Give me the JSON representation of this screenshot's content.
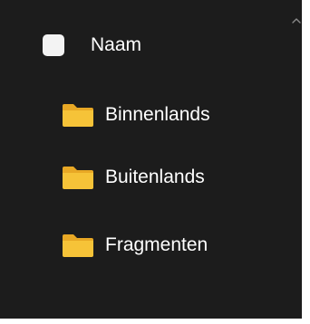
{
  "header": {
    "name_column_label": "Naam"
  },
  "folders": [
    {
      "label": "Binnenlands",
      "icon": "folder-icon"
    },
    {
      "label": "Buitenlands",
      "icon": "folder-icon"
    },
    {
      "label": "Fragmenten",
      "icon": "folder-icon"
    }
  ],
  "colors": {
    "background": "#1c1c1c",
    "text": "#ffffff",
    "folder_body": "#f6c338",
    "folder_tab": "#e8a825",
    "checkbox": "#f3f3f3"
  },
  "scroll_icon": "chevron-up-icon"
}
